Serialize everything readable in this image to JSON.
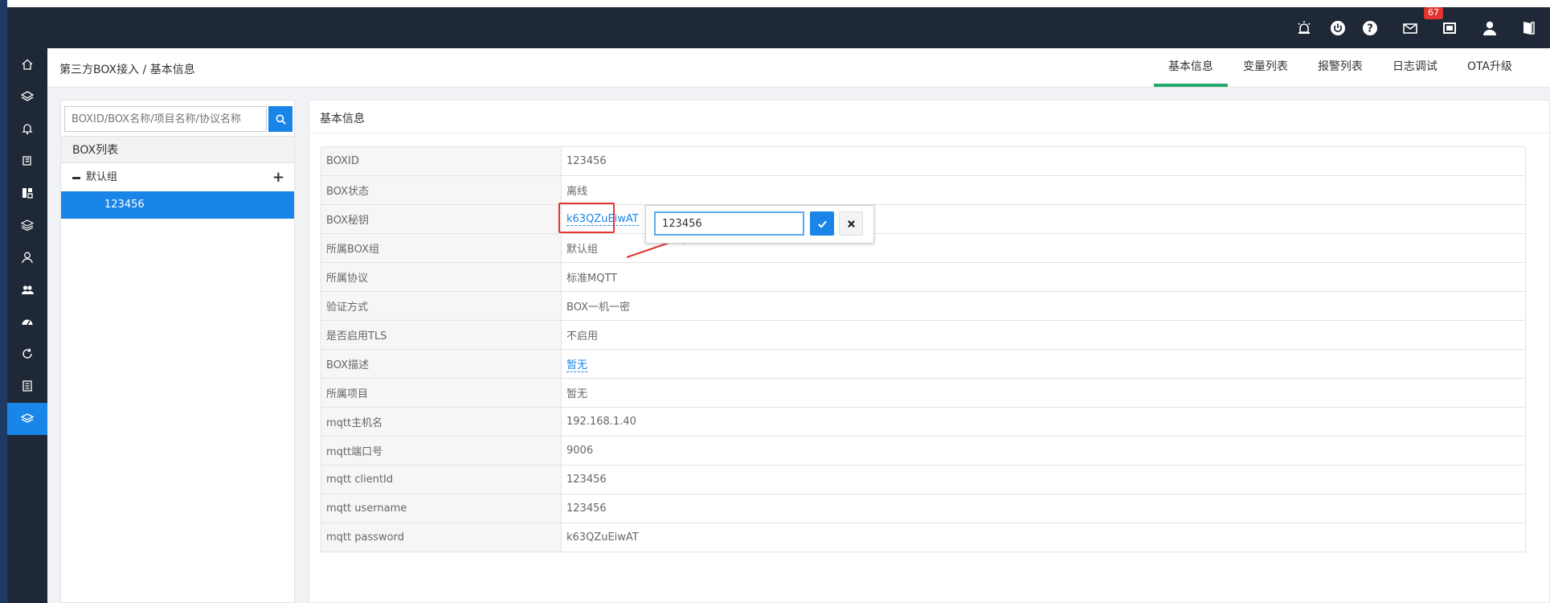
{
  "colors": {
    "topbar": "#1f2836",
    "accent": "#1a85e8",
    "active_tab": "#22a96c",
    "danger": "#e3342f"
  },
  "topbar": {
    "icons": [
      "alarm-light-icon",
      "power-icon",
      "help-icon",
      "mail-icon",
      "fullscreen-icon",
      "user-icon",
      "logout-icon"
    ],
    "mail_badge": "67"
  },
  "sidenav": {
    "icons": [
      "home-icon",
      "layers-icon",
      "bell-icon",
      "copy-icon",
      "dashboard-icon",
      "stack-icon",
      "user-icon",
      "users-icon",
      "gauge-icon",
      "refresh-icon",
      "book-icon",
      "box-access-icon"
    ],
    "active_index": 11
  },
  "header": {
    "breadcrumb": "第三方BOX接入 / 基本信息",
    "tabs": [
      {
        "label": "基本信息",
        "active": true
      },
      {
        "label": "变量列表"
      },
      {
        "label": "报警列表"
      },
      {
        "label": "日志调试"
      },
      {
        "label": "OTA升级"
      }
    ]
  },
  "leftpanel": {
    "search_placeholder": "BOXID/BOX名称/项目名称/协议名称",
    "list_title": "BOX列表",
    "group_label": "默认组",
    "box_item": "123456"
  },
  "main": {
    "title": "基本信息",
    "rows": [
      {
        "key": "BOXID",
        "value": "123456"
      },
      {
        "key": "BOX状态",
        "value": "离线"
      },
      {
        "key": "BOX秘钥",
        "value": "k63QZuEiwAT"
      },
      {
        "key": "所属BOX组",
        "value": "默认组"
      },
      {
        "key": "所属协议",
        "value": "标准MQTT"
      },
      {
        "key": "验证方式",
        "value": "BOX一机一密"
      },
      {
        "key": "是否启用TLS",
        "value": "不启用"
      },
      {
        "key": "BOX描述",
        "value": "暂无"
      },
      {
        "key": "所属项目",
        "value": "暂无"
      },
      {
        "key": "mqtt主机名",
        "value": "192.168.1.40"
      },
      {
        "key": "mqtt端口号",
        "value": "9006"
      },
      {
        "key": "mqtt clientId",
        "value": "123456"
      },
      {
        "key": "mqtt username",
        "value": "123456"
      },
      {
        "key": "mqtt password",
        "value": "k63QZuEiwAT"
      }
    ]
  },
  "popup": {
    "input_value": "123456"
  }
}
